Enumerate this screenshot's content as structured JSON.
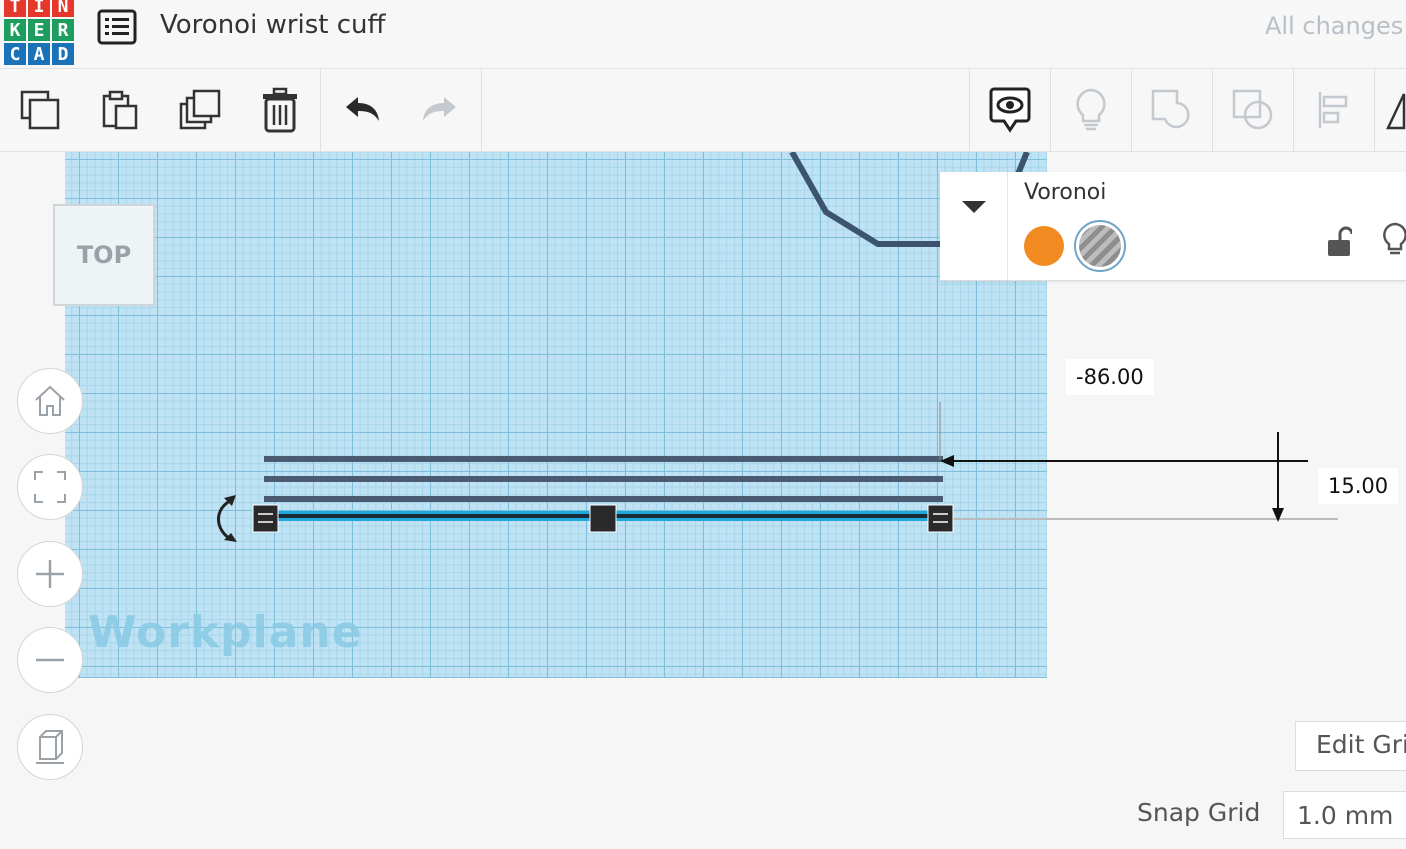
{
  "header": {
    "logo_letters": [
      "T",
      "I",
      "N",
      "K",
      "E",
      "R",
      "C",
      "A",
      "D"
    ],
    "logo_colors": [
      "#e5382a",
      "#e5382a",
      "#e5382a",
      "#1e9e5e",
      "#1e9e5e",
      "#1e9e5e",
      "#1a73b8",
      "#1a73b8",
      "#1a73b8"
    ],
    "title": "Voronoi wrist cuff",
    "save_status": "All changes"
  },
  "toolbar": {
    "icons": [
      "copy-icon",
      "paste-icon",
      "duplicate-icon",
      "delete-icon",
      "undo-icon",
      "redo-icon",
      "notes-icon",
      "lightbulb-icon",
      "group-icon",
      "ungroup-icon",
      "align-icon",
      "mirror-icon"
    ]
  },
  "canvas": {
    "workplane_label": "Workplane",
    "viewcube_face": "TOP",
    "nav_icons": [
      "home-icon",
      "fit-view-icon",
      "zoom-in-icon",
      "zoom-out-icon",
      "perspective-icon"
    ]
  },
  "inspector": {
    "shape_name": "Voronoi",
    "solid_color": "#f28a22",
    "hole_label": "hole"
  },
  "dimensions": {
    "offset": "-86.00",
    "height": "15.00"
  },
  "grid_controls": {
    "edit_grid": "Edit Grid",
    "snap_label": "Snap Grid",
    "snap_value": "1.0 mm"
  }
}
